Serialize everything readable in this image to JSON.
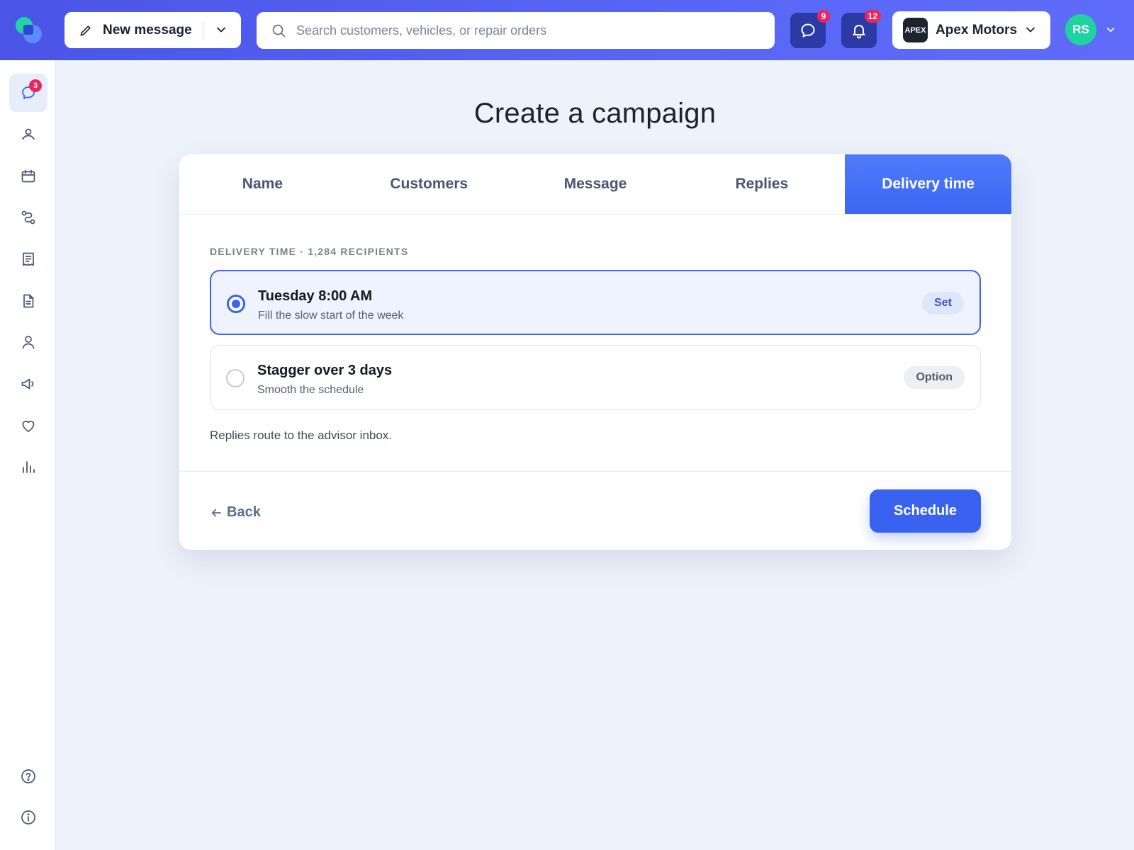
{
  "topbar": {
    "new_message_label": "New message",
    "search_placeholder": "Search customers, vehicles, or repair orders",
    "chat_badge": "9",
    "notifications_badge": "12",
    "company_logo_text": "APEX",
    "company_name": "Apex Motors",
    "avatar_initials": "RS"
  },
  "sidebar": {
    "items": [
      {
        "icon": "chat-icon",
        "badge": "3",
        "active": true
      },
      {
        "icon": "customers-icon"
      },
      {
        "icon": "calendar-icon"
      },
      {
        "icon": "workflow-icon"
      },
      {
        "icon": "receipt-icon"
      },
      {
        "icon": "document-icon"
      },
      {
        "icon": "user-icon"
      },
      {
        "icon": "megaphone-icon"
      },
      {
        "icon": "heart-icon"
      },
      {
        "icon": "bar-chart-icon"
      },
      {
        "icon": "help-icon"
      },
      {
        "icon": "info-icon"
      }
    ]
  },
  "page": {
    "title": "Create a campaign"
  },
  "tabs": [
    {
      "label": "Name",
      "active": false
    },
    {
      "label": "Customers",
      "active": false
    },
    {
      "label": "Message",
      "active": false
    },
    {
      "label": "Replies",
      "active": false
    },
    {
      "label": "Delivery time",
      "active": true
    }
  ],
  "delivery": {
    "section_label": "DELIVERY TIME · 1,284 RECIPIENTS",
    "options": [
      {
        "title": "Tuesday 8:00 AM",
        "subtitle": "Fill the slow start of the week",
        "pill": "Set",
        "selected": true
      },
      {
        "title": "Stagger over 3 days",
        "subtitle": "Smooth the schedule",
        "pill": "Option",
        "selected": false
      }
    ],
    "note": "Replies route to the advisor inbox."
  },
  "footer": {
    "back_label": "Back",
    "schedule_label": "Schedule"
  },
  "colors": {
    "accent": "#3a62f0",
    "topbar": "#5866f5",
    "badge": "#f0245c",
    "avatar": "#1fd3a0"
  }
}
